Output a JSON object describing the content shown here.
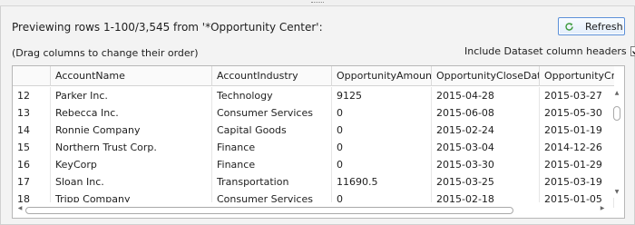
{
  "preview": {
    "info_text": "Previewing rows 1-100/3,545 from '*Opportunity Center':",
    "hint_text": "(Drag columns to change their order)"
  },
  "toolbar": {
    "refresh_label": "Refresh",
    "refresh_icon": "refresh-icon"
  },
  "options": {
    "include_headers_label": "Include Dataset column headers",
    "include_headers_checked": true
  },
  "grid": {
    "columns": [
      "",
      "AccountName",
      "AccountIndustry",
      "OpportunityAmount",
      "OpportunityCloseDate",
      "OpportunityCreat"
    ],
    "rows": [
      [
        "12",
        "Parker Inc.",
        "Technology",
        "9125",
        "2015-04-28",
        "2015-03-27"
      ],
      [
        "13",
        "Rebecca Inc.",
        "Consumer Services",
        "0",
        "2015-06-08",
        "2015-05-30"
      ],
      [
        "14",
        "Ronnie Company",
        "Capital Goods",
        "0",
        "2015-02-24",
        "2015-01-19"
      ],
      [
        "15",
        "Northern Trust Corp.",
        "Finance",
        "0",
        "2015-03-04",
        "2014-12-26"
      ],
      [
        "16",
        "KeyCorp",
        "Finance",
        "0",
        "2015-03-30",
        "2015-01-29"
      ],
      [
        "17",
        "Sloan Inc.",
        "Transportation",
        "11690.5",
        "2015-03-25",
        "2015-03-19"
      ],
      [
        "18",
        "Tripp Company",
        "Consumer Services",
        "0",
        "2015-02-18",
        "2015-01-05"
      ]
    ]
  }
}
